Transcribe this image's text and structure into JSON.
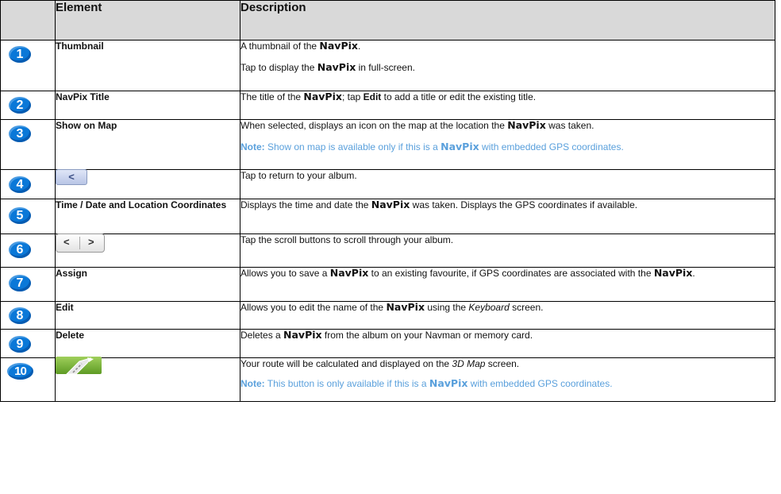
{
  "header": {
    "num": "",
    "element": "Element",
    "description": "Description"
  },
  "rows": [
    {
      "num": "1",
      "element": "Thumbnail",
      "d1a": "A thumbnail of the ",
      "d1b": "NavPix",
      "d1c": ".",
      "d2a": "Tap to display the ",
      "d2b": "NavPix",
      "d2c": " in full-screen."
    },
    {
      "num": "2",
      "element": "NavPix Title",
      "d1a": "The title of the ",
      "d1b": "NavPix",
      "d1c": "; tap ",
      "d1d": "Edit",
      "d1e": " to add a title or edit the existing title."
    },
    {
      "num": "3",
      "element": "Show on Map",
      "d1a": "When selected, displays an icon on the map at the location the ",
      "d1b": "NavPix",
      "d1c": " was taken.",
      "note_label": "Note:",
      "note_a": " Show on map is available only if this is a ",
      "note_b": "NavPix",
      "note_c": " with embedded GPS coordinates."
    },
    {
      "num": "4",
      "button_glyph": "<",
      "d1a": "Tap to return to your album."
    },
    {
      "num": "5",
      "element": "Time / Date and Location Coordinates",
      "d1a": "Displays the time and date the ",
      "d1b": "NavPix",
      "d1c": " was taken. Displays the GPS coordinates if available."
    },
    {
      "num": "6",
      "left_glyph": "<",
      "right_glyph": ">",
      "d1a": "Tap the scroll buttons to scroll through your album."
    },
    {
      "num": "7",
      "element": "Assign",
      "d1a": "Allows you to save a ",
      "d1b": "NavPix",
      "d1c": " to an existing favourite, if GPS coordinates are associated with the ",
      "d1d": "NavPix",
      "d1e": "."
    },
    {
      "num": "8",
      "element": "Edit",
      "d1a": "Allows you to edit the name of the ",
      "d1b": "NavPix",
      "d1c": " using the ",
      "d1d": "Keyboard",
      "d1e": " screen."
    },
    {
      "num": "9",
      "element": "Delete",
      "d1a": "Deletes a ",
      "d1b": "NavPix",
      "d1c": " from the album on your Navman or memory card."
    },
    {
      "num": "10",
      "d1a": "Your route will be calculated and displayed on the ",
      "d1b": "3D Map",
      "d1c": " screen.",
      "note_label": "Note:",
      "note_a": " This button is only available if this is a ",
      "note_b": "NavPix",
      "note_c": " with embedded GPS coordinates."
    }
  ],
  "colors": {
    "header_bg": "#d9d9d9",
    "badge": "#0a78d8",
    "note": "#5aa0dc",
    "route_button": "#7db63b"
  },
  "icons": {
    "row4": "back-arrow-icon",
    "row6": "scroll-buttons-icon",
    "row10": "route-road-icon"
  }
}
